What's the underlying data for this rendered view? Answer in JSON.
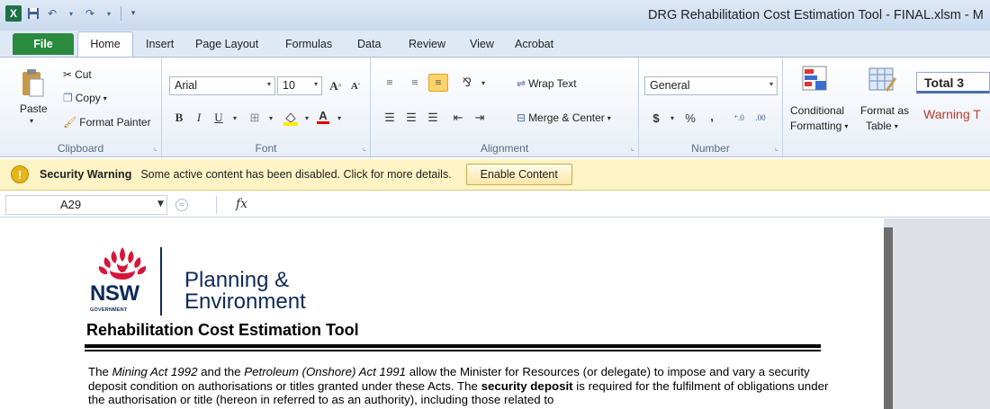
{
  "window": {
    "title": "DRG Rehabilitation Cost Estimation Tool - FINAL.xlsm - M"
  },
  "qat": {
    "app_icon": "excel-icon",
    "save_icon": "save-icon",
    "undo_icon": "undo-icon",
    "redo_icon": "redo-icon"
  },
  "tabs": [
    "File",
    "Home",
    "Insert",
    "Page Layout",
    "Formulas",
    "Data",
    "Review",
    "View",
    "Acrobat"
  ],
  "clipboard": {
    "paste": "Paste",
    "cut": "Cut",
    "copy": "Copy",
    "format_painter": "Format Painter",
    "label": "Clipboard"
  },
  "font": {
    "name": "Arial",
    "size": "10",
    "label": "Font",
    "bold": "B",
    "italic": "I",
    "underline": "U"
  },
  "alignment": {
    "wrap_text": "Wrap Text",
    "merge_center": "Merge & Center",
    "label": "Alignment"
  },
  "number": {
    "format": "General",
    "currency": "$",
    "percent": "%",
    "comma": ",",
    "label": "Number"
  },
  "styles": {
    "conditional_1": "Conditional",
    "conditional_2": "Formatting",
    "format_as_1": "Format as",
    "format_as_2": "Table",
    "total3": "Total 3",
    "warning": "Warning T"
  },
  "security": {
    "title": "Security Warning",
    "message": "Some active content has been disabled. Click for more details.",
    "button": "Enable Content"
  },
  "formula_bar": {
    "name_box": "A29",
    "fx": "fx",
    "cancel": "="
  },
  "document": {
    "logo_nsw": "NSW",
    "logo_gov": "GOVERNMENT",
    "logo_planning": "Planning &",
    "logo_environment": "Environment",
    "title": "Rehabilitation Cost Estimation Tool",
    "p1_a": "The ",
    "p1_b": "Mining Act 1992",
    "p1_c": " and the ",
    "p1_d": "Petroleum (Onshore) Act 1991",
    "p1_e": " allow the Minister for Resources (or delegate) to impose and vary a security deposit condition on authorisations or titles granted under these Acts. The ",
    "p1_f": "security deposit",
    "p1_g": " is required for the fulfilment of obligations under the authorisation or title (hereon in referred to as an authority), including those related to"
  },
  "colors": {
    "file_tab": "#2a8a3e",
    "security_bar": "#fdf3c4",
    "nsw_blue": "#0e2a5a",
    "nsw_red": "#d7153a",
    "warning_text": "#c0392b"
  }
}
